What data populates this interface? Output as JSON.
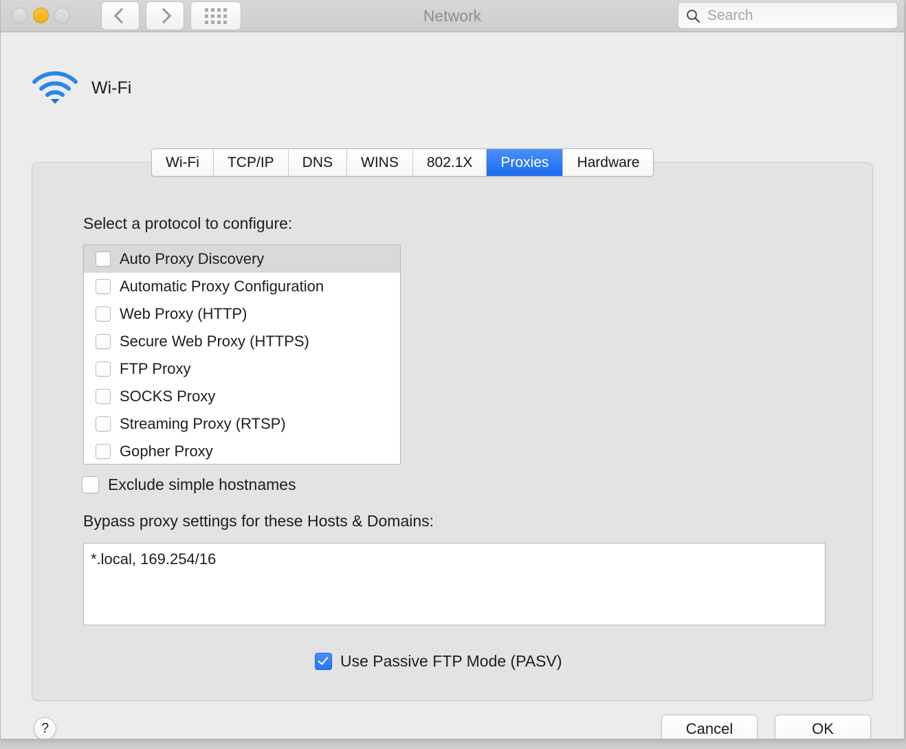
{
  "window": {
    "title": "Network",
    "traffic_lights": [
      {
        "name": "close",
        "state": "inactive",
        "color": "#dcdcdc"
      },
      {
        "name": "minimize",
        "state": "active",
        "color": "#f6b312"
      },
      {
        "name": "zoom",
        "state": "inactive",
        "color": "#dcdcdc"
      }
    ],
    "nav": {
      "back_icon": "chevron-left-icon",
      "forward_icon": "chevron-right-icon",
      "show_all_icon": "grid-icon"
    },
    "search": {
      "icon": "search-icon",
      "placeholder": "Search",
      "value": ""
    }
  },
  "service": {
    "icon": "wifi-icon",
    "name": "Wi-Fi",
    "accent": "#2a7ae4"
  },
  "tabs": [
    {
      "label": "Wi-Fi",
      "active": false
    },
    {
      "label": "TCP/IP",
      "active": false
    },
    {
      "label": "DNS",
      "active": false
    },
    {
      "label": "WINS",
      "active": false
    },
    {
      "label": "802.1X",
      "active": false
    },
    {
      "label": "Proxies",
      "active": true
    },
    {
      "label": "Hardware",
      "active": false
    }
  ],
  "selected_tab_color": "#2f7cf5",
  "proxies": {
    "protocol_label": "Select a protocol to configure:",
    "protocols": [
      {
        "label": "Auto Proxy Discovery",
        "checked": false,
        "selected": true
      },
      {
        "label": "Automatic Proxy Configuration",
        "checked": false,
        "selected": false
      },
      {
        "label": "Web Proxy (HTTP)",
        "checked": false,
        "selected": false
      },
      {
        "label": "Secure Web Proxy (HTTPS)",
        "checked": false,
        "selected": false
      },
      {
        "label": "FTP Proxy",
        "checked": false,
        "selected": false
      },
      {
        "label": "SOCKS Proxy",
        "checked": false,
        "selected": false
      },
      {
        "label": "Streaming Proxy (RTSP)",
        "checked": false,
        "selected": false
      },
      {
        "label": "Gopher Proxy",
        "checked": false,
        "selected": false
      }
    ],
    "exclude_simple_hostnames": {
      "label": "Exclude simple hostnames",
      "checked": false
    },
    "bypass_label": "Bypass proxy settings for these Hosts & Domains:",
    "bypass_value": "*.local, 169.254/16",
    "passive_ftp": {
      "label": "Use Passive FTP Mode (PASV)",
      "checked": true
    }
  },
  "footer": {
    "help_label": "?",
    "cancel_label": "Cancel",
    "ok_label": "OK"
  }
}
